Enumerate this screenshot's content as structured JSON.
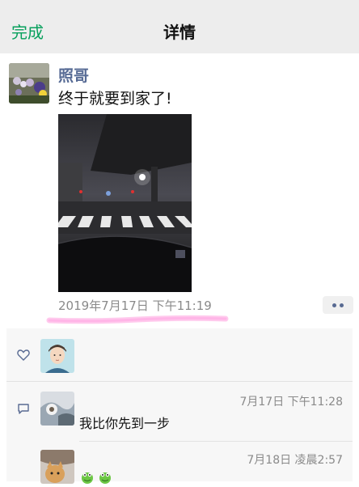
{
  "nav": {
    "done_label": "完成",
    "title": "详情"
  },
  "post": {
    "author": "照哥",
    "text": "终于就要到家了!",
    "time": "2019年7月17日 下午11:19",
    "more_icon": "more-dots-icon"
  },
  "likes": {
    "icon": "heart-icon"
  },
  "comments": {
    "icon": "comment-icon",
    "items": [
      {
        "text": "我比你先到一步",
        "time": "7月17日 下午11:28"
      },
      {
        "text": "",
        "time": "7月18日 凌晨2:57"
      }
    ]
  },
  "colors": {
    "accent": "#07a05c",
    "name": "#576b95",
    "highlight": "#ff66cc"
  }
}
